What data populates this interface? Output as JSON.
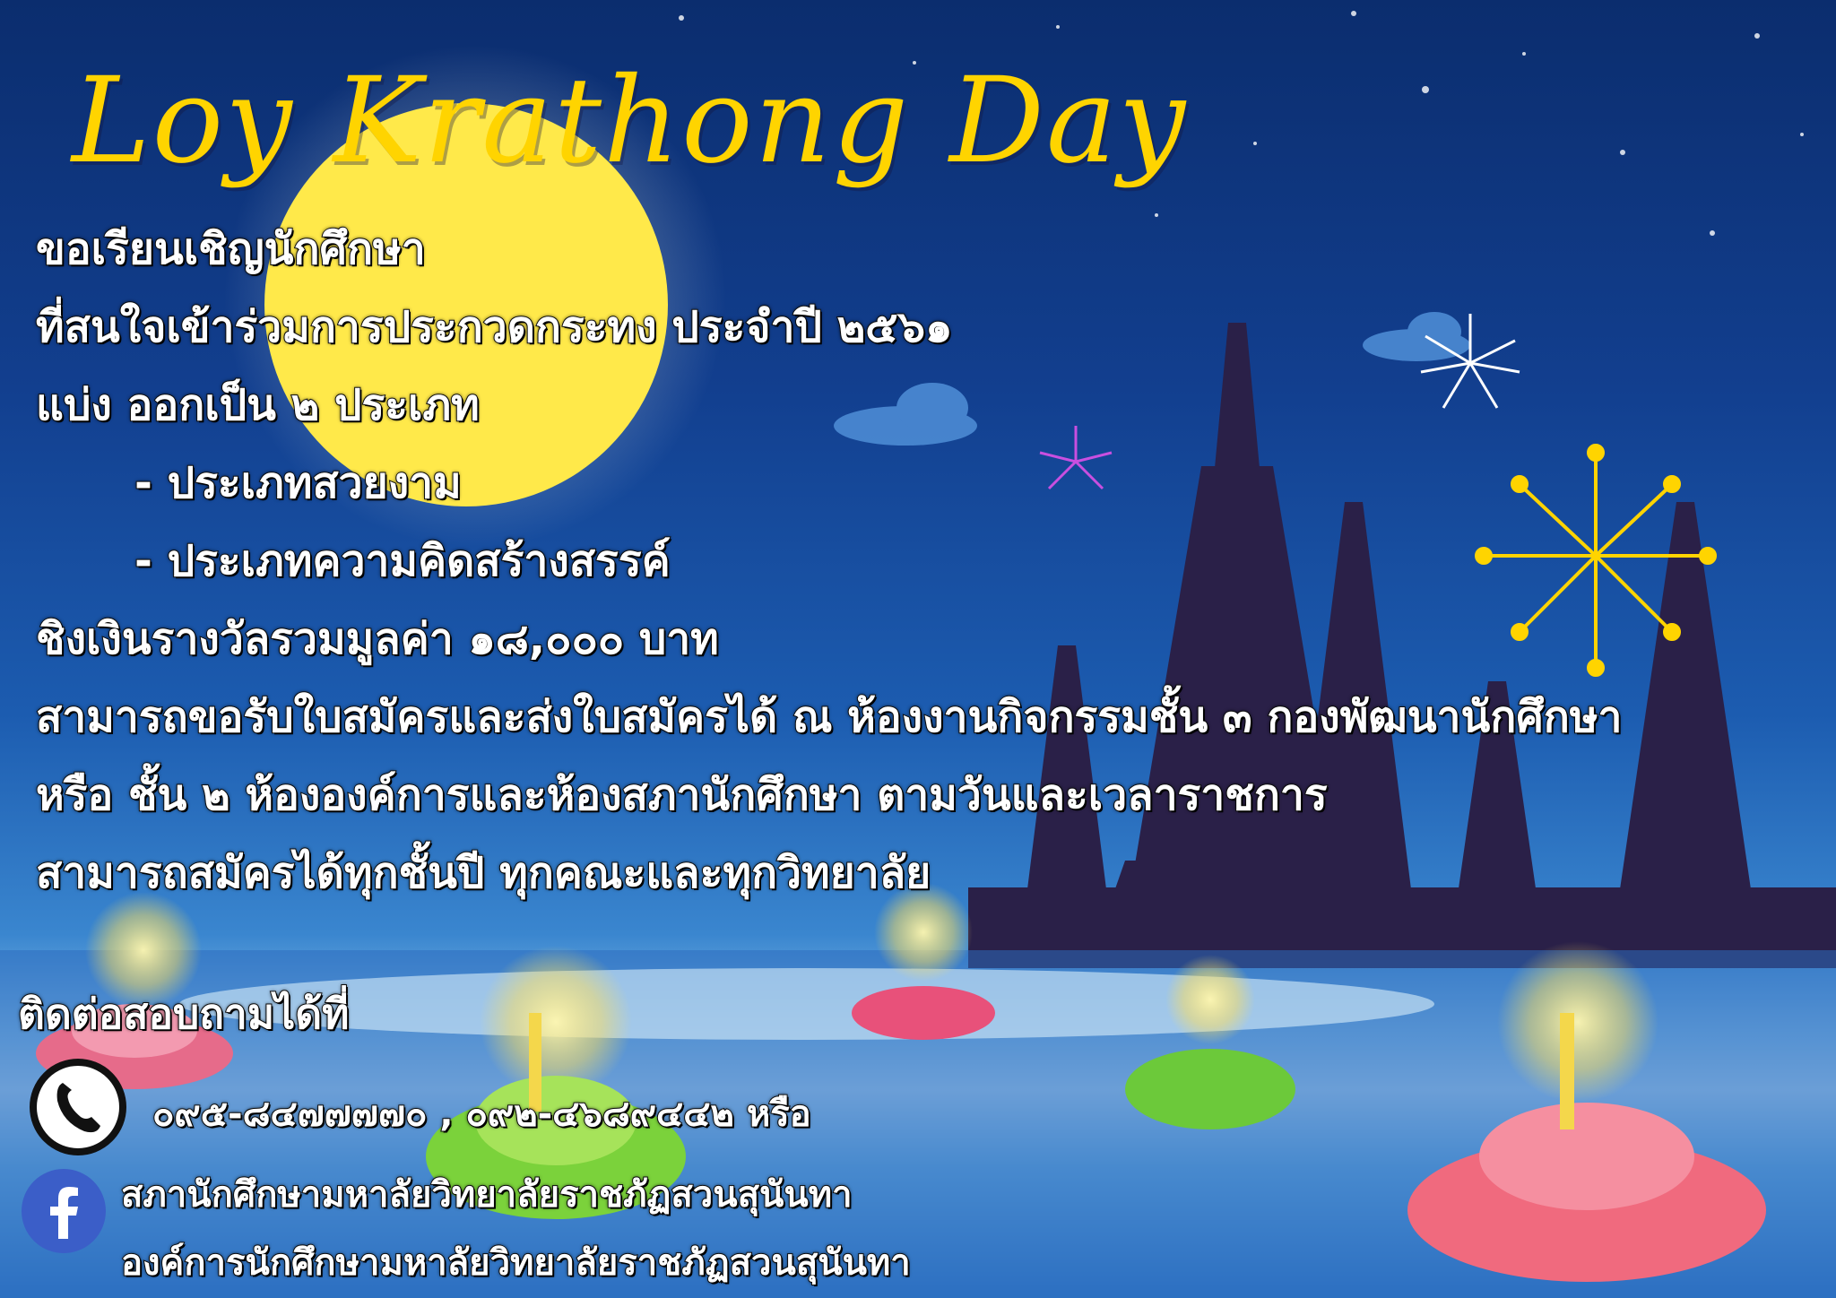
{
  "poster": {
    "title": "Loy Krathong Day",
    "invite": "ขอเรียนเชิญนักศึกษา",
    "interest": "ที่สนใจเข้าร่วมการประกวดกระทง ประจำปี ๒๕๖๑",
    "split": "แบ่ง ออกเป็น ๒ ประเภท",
    "category_1": "- ประเภทสวยงาม",
    "category_2": "- ประเภทความคิดสร้างสรรค์",
    "prize": "ชิงเงินรางวัลรวมมูลค่า ๑๘,๐๐๐ บาท",
    "apply_place": "สามารถขอรับใบสมัครและส่งใบสมัครได้ ณ ห้องงานกิจกรรมชั้น ๓ กองพัฒนานักศึกษา",
    "apply_place_2": "หรือ ชั้น ๒ ห้ององค์การและห้องสภานักศึกษา ตามวันและเวลาราชการ",
    "eligibility": "สามารถสมัครได้ทุกชั้นปี ทุกคณะและทุกวิทยาลัย"
  },
  "contact": {
    "heading": "ติดต่อสอบถามได้ที่",
    "phones": "๐๙๕-๘๔๗๗๗๗๐ , ๐๙๒-๔๖๘๙๔๔๒  หรือ",
    "facebook_1": "สภานักศึกษามหาลัยวิทยาลัยราชภัฏสวนสุนันทา",
    "facebook_2": "องค์การนักศึกษามหาลัยวิทยาลัยราชภัฏสวนสุนันทา"
  },
  "icons": {
    "phone": "phone-icon",
    "facebook": "facebook-icon"
  },
  "colors": {
    "title": "#ffd400",
    "sky": "#123f8f",
    "moon": "#ffe94a",
    "temple": "#2a2048"
  }
}
